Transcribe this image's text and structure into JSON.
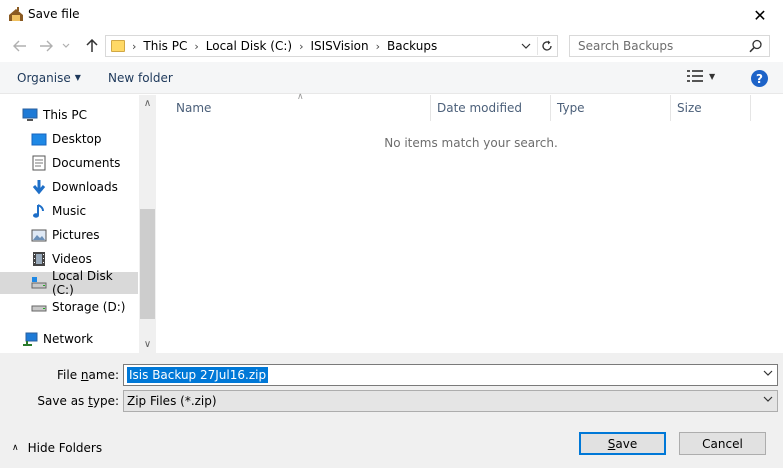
{
  "window": {
    "title": "Save file",
    "close_glyph": "✕"
  },
  "address": {
    "crumbs": [
      "This PC",
      "Local Disk (C:)",
      "ISISVision",
      "Backups"
    ]
  },
  "search": {
    "placeholder": "Search Backups"
  },
  "toolbar": {
    "organise_label": "Organise",
    "new_folder_label": "New folder",
    "help_label": "?"
  },
  "tree": {
    "items": [
      {
        "label": "This PC",
        "icon": "computer-icon"
      },
      {
        "label": "Desktop",
        "icon": "desktop-icon"
      },
      {
        "label": "Documents",
        "icon": "documents-icon"
      },
      {
        "label": "Downloads",
        "icon": "downloads-icon"
      },
      {
        "label": "Music",
        "icon": "music-icon"
      },
      {
        "label": "Pictures",
        "icon": "pictures-icon"
      },
      {
        "label": "Videos",
        "icon": "videos-icon"
      },
      {
        "label": "Local Disk (C:)",
        "icon": "drive-icon",
        "selected": true
      },
      {
        "label": "Storage (D:)",
        "icon": "drive-icon"
      },
      {
        "label": "Network",
        "icon": "network-icon"
      }
    ]
  },
  "columns": [
    "Name",
    "Date modified",
    "Type",
    "Size"
  ],
  "empty_message": "No items match your search.",
  "form": {
    "file_name_label_pre": "File ",
    "file_name_label_key": "n",
    "file_name_label_post": "ame:",
    "file_name_value": "Isis Backup 27Jul16.zip",
    "save_type_label_pre": "Save as ",
    "save_type_label_key": "t",
    "save_type_label_post": "ype:",
    "save_type_value": "Zip Files (*.zip)"
  },
  "footer": {
    "hide_folders_label": "Hide Folders",
    "save_key": "S",
    "save_rest": "ave",
    "cancel_label": "Cancel"
  },
  "colors": {
    "accent": "#0078d7",
    "help": "#1d63c8",
    "selected_row": "#d9d9d9"
  }
}
